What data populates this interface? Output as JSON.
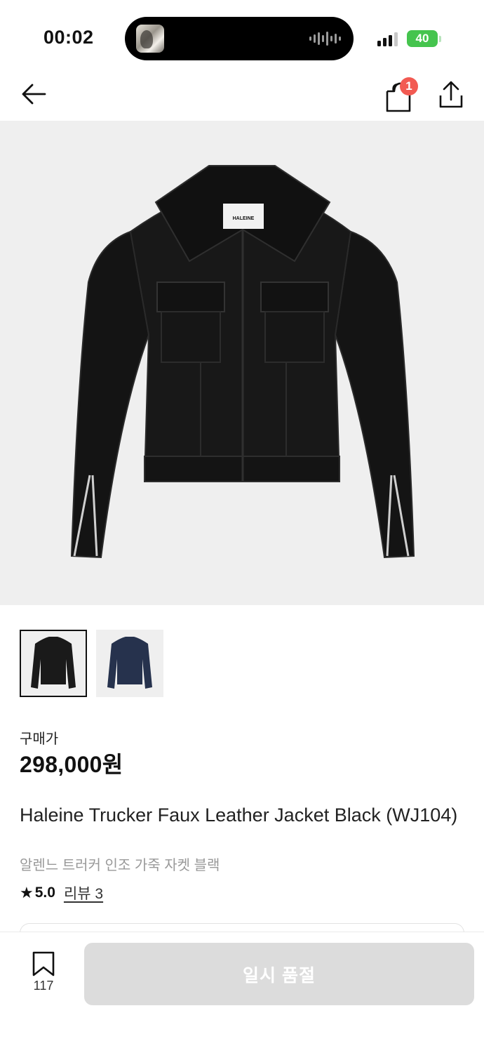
{
  "status_bar": {
    "time": "00:02",
    "battery": "40"
  },
  "nav": {
    "back_icon": "arrow-left-icon",
    "cart_icon": "shopping-bag-icon",
    "cart_count": "1",
    "share_icon": "share-icon"
  },
  "product": {
    "image_label": "HALEINE",
    "thumbnails": [
      {
        "color_name": "black",
        "color": "#1a1a1a",
        "selected": true
      },
      {
        "color_name": "navy",
        "color": "#26324d",
        "selected": false
      }
    ],
    "price_label": "구매가",
    "price": "298,000원",
    "title": "Haleine Trucker Faux Leather Jacket Black (WJ104)",
    "subtitle": "알렌느 트러커 인조 가죽 자켓 블랙",
    "rating": "5.0",
    "review_link": "리뷰 3"
  },
  "bottom_bar": {
    "bookmark_icon": "bookmark-icon",
    "bookmark_count": "117",
    "soldout_label": "일시 품절"
  },
  "colors": {
    "badge": "#f25a52",
    "battery": "#45c44e",
    "disabled_button": "#dcdcdc"
  }
}
